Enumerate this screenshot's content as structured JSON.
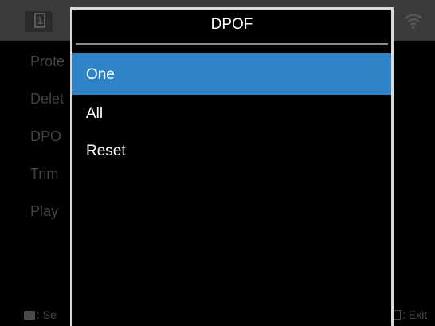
{
  "background_menu": {
    "items": [
      {
        "label": "Prote"
      },
      {
        "label": "Delet"
      },
      {
        "label": "DPO"
      },
      {
        "label": "Trim"
      },
      {
        "label": "Play"
      }
    ],
    "tab_icon_label": "1",
    "footer_left": ": Se",
    "footer_right": ": Exit"
  },
  "dialog": {
    "title": "DPOF",
    "options": [
      {
        "label": "One",
        "selected": true
      },
      {
        "label": "All",
        "selected": false
      },
      {
        "label": "Reset",
        "selected": false
      }
    ]
  },
  "colors": {
    "selection": "#2f84c8",
    "dialog_border": "#d9d9d9",
    "topbar": "#3b3b3b"
  }
}
